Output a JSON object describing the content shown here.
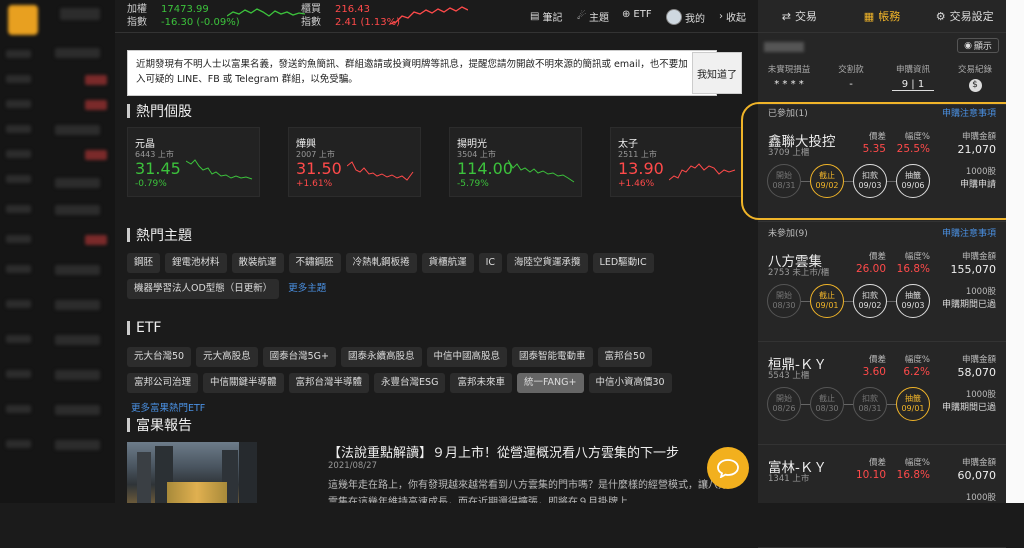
{
  "indices": [
    {
      "line1_label": "加權",
      "line1_value": "17473.99",
      "line2_label": "指數",
      "line2_value": "-16.30 (-0.09%)",
      "trend": "down",
      "color": "#3cc23c"
    },
    {
      "line1_label": "櫃買",
      "line1_value": "216.43",
      "line2_label": "指數",
      "line2_value": "2.41 (1.13%)",
      "trend": "up",
      "color": "#ff4a4a"
    }
  ],
  "topnav": {
    "notes": "筆記",
    "topics": "主題",
    "etf": "ETF",
    "mine": "我的",
    "collapse": "收起"
  },
  "notice": {
    "text": "近期發現有不明人士以富果名義，發送釣魚簡訊、群組邀請或投資明牌等訊息，提醒您請勿開啟不明來源的簡訊或 email，也不要加入可疑的 LINE、FB 或 Telegram 群組，以免受騙。",
    "button": "我知道了"
  },
  "hot_stocks": {
    "title": "熱門個股",
    "items": [
      {
        "name": "元晶",
        "sub": "6443 上市",
        "price": "31.45",
        "change": "-0.79%",
        "dir": "down"
      },
      {
        "name": "燁興",
        "sub": "2007 上市",
        "price": "31.50",
        "change": "+1.61%",
        "dir": "up"
      },
      {
        "name": "揚明光",
        "sub": "3504 上市",
        "price": "114.00",
        "change": "-5.79%",
        "dir": "down"
      },
      {
        "name": "太子",
        "sub": "2511 上市",
        "price": "13.90",
        "change": "+1.46%",
        "dir": "up"
      }
    ]
  },
  "hot_topics": {
    "title": "熱門主題",
    "tags": [
      "鋼胚",
      "鋰電池材料",
      "散裝航運",
      "不鏽鋼胚",
      "冷熱軋鋼板捲",
      "貨櫃航運",
      "IC",
      "海陸空貨運承攬",
      "LED驅動IC",
      "機器學習法人OD型態（日更新）"
    ],
    "more": "更多主題"
  },
  "etf": {
    "title": "ETF",
    "tags": [
      "元大台灣50",
      "元大高股息",
      "國泰台灣5G+",
      "國泰永續高股息",
      "中信中國高股息",
      "國泰智能電動車",
      "富邦台50",
      "富邦公司治理",
      "中信關鍵半導體",
      "富邦台灣半導體",
      "永豐台灣ESG",
      "富邦未來車",
      "統一FANG+",
      "中信小資高價30"
    ],
    "selected_tag": "統一FANG+",
    "more": "更多富果熱門ETF"
  },
  "report": {
    "title": "富果報告",
    "article_title": "【法說重點解讀】９月上市！從營運概況看八方雲集的下一步",
    "date": "2021/08/27",
    "body": "這幾年走在路上，你有發現越來越常看到八方雲集的門市嗎？是什麼樣的經營模式，讓八方雲集在這幾年維持高速成長，而在近期還得擴張，即將在９月掛牌上"
  },
  "right_panel": {
    "tabs": [
      "交易",
      "帳務",
      "交易設定"
    ],
    "active_tab": "帳務",
    "show_button": "顯示",
    "stats": [
      {
        "label": "未實現損益",
        "value": "* * * *"
      },
      {
        "label": "交割款",
        "value": "-"
      },
      {
        "label": "申購資訊",
        "value": "9 | 1"
      },
      {
        "label": "交易紀錄",
        "value": "$"
      }
    ],
    "joined_header": "已參加(1)",
    "unjoined_header": "未參加(9)",
    "notes_link": "申購注意事項",
    "price_label": "價差",
    "pct_label": "幅度%",
    "amount_label": "申購金額",
    "ipos": [
      {
        "name": "鑫聯大投控",
        "code": "3709 上櫃",
        "price": "5.35",
        "pct": "25.5%",
        "amount": "21,070",
        "shares": "1000股",
        "status": "申購申請",
        "steps": [
          {
            "label": "開始",
            "date": "08/31",
            "state": "off"
          },
          {
            "label": "截止",
            "date": "09/02",
            "state": "cur"
          },
          {
            "label": "扣款",
            "date": "09/03",
            "state": "on"
          },
          {
            "label": "抽籤",
            "date": "09/06",
            "state": "on"
          }
        ]
      },
      {
        "name": "八方雲集",
        "code": "2753 未上市/櫃",
        "price": "26.00",
        "pct": "16.8%",
        "amount": "155,070",
        "shares": "1000股",
        "status": "申購期間已過",
        "steps": [
          {
            "label": "開始",
            "date": "08/30",
            "state": "off"
          },
          {
            "label": "截止",
            "date": "09/01",
            "state": "cur"
          },
          {
            "label": "扣款",
            "date": "09/02",
            "state": "on"
          },
          {
            "label": "抽籤",
            "date": "09/03",
            "state": "on"
          }
        ]
      },
      {
        "name": "桓鼎-ＫＹ",
        "code": "5543 上櫃",
        "price": "3.60",
        "pct": "6.2%",
        "amount": "58,070",
        "shares": "1000股",
        "status": "申購期間已過",
        "steps": [
          {
            "label": "開始",
            "date": "08/26",
            "state": "off"
          },
          {
            "label": "截止",
            "date": "08/30",
            "state": "off"
          },
          {
            "label": "扣款",
            "date": "08/31",
            "state": "off"
          },
          {
            "label": "抽籤",
            "date": "09/01",
            "state": "cur"
          }
        ]
      },
      {
        "name": "富林-ＫＹ",
        "code": "1341 上市",
        "price": "10.10",
        "pct": "16.8%",
        "amount": "60,070",
        "shares": "1000股",
        "status": "",
        "steps": []
      }
    ]
  }
}
